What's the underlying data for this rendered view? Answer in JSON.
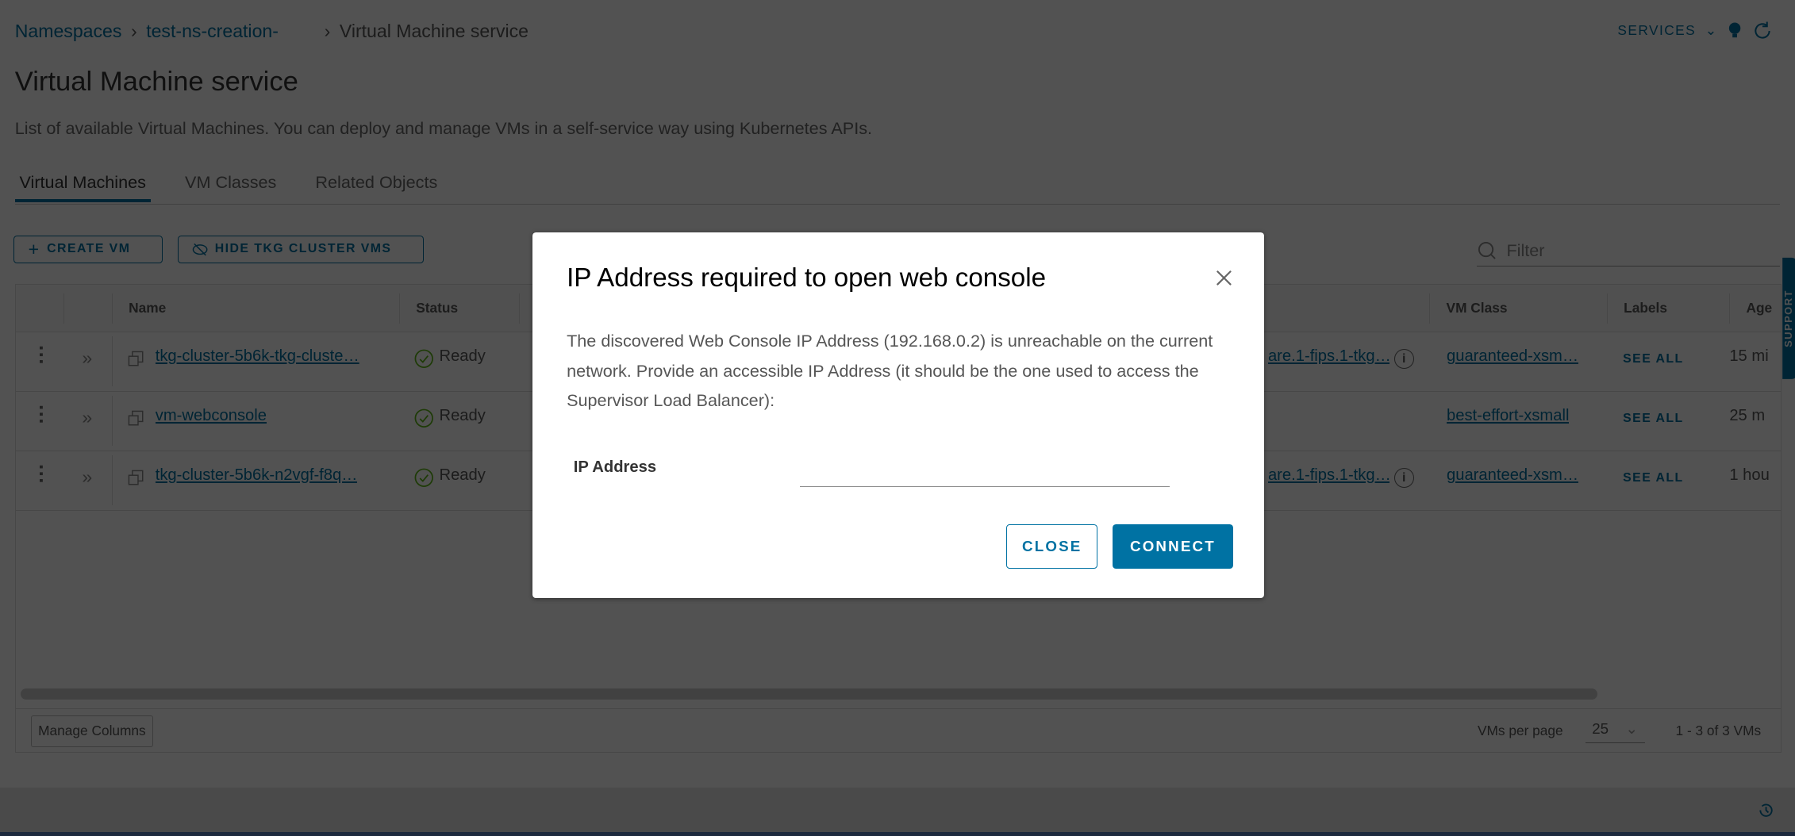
{
  "breadcrumb": [
    "Namespaces",
    "test-ns-creation-",
    "Virtual Machine service"
  ],
  "header": {
    "services_label": "SERVICES",
    "title": "Virtual Machine service",
    "description": "List of available Virtual Machines. You can deploy and manage VMs in a self-service way using Kubernetes APIs."
  },
  "tabs": [
    {
      "label": "Virtual Machines",
      "active": true
    },
    {
      "label": "VM Classes"
    },
    {
      "label": "Related Objects"
    }
  ],
  "toolbar": {
    "create_vm": "CREATE VM",
    "hide_tkg": "HIDE TKG CLUSTER VMS",
    "filter_placeholder": "Filter"
  },
  "table": {
    "columns": [
      "Name",
      "Status",
      "VM Class",
      "Labels",
      "Age"
    ],
    "rows": [
      {
        "name": "tkg-cluster-5b6k-tkg-cluste…",
        "status": "Ready",
        "image": "are.1-fips.1-tkg…",
        "vm_class": "guaranteed-xsm…",
        "labels": "SEE ALL",
        "age": "15 mi"
      },
      {
        "name": "vm-webconsole",
        "status": "Ready",
        "image": "",
        "vm_class": "best-effort-xsmall",
        "labels": "SEE ALL",
        "age": "25 m"
      },
      {
        "name": "tkg-cluster-5b6k-n2vgf-f8q…",
        "status": "Ready",
        "image": "are.1-fips.1-tkg…",
        "vm_class": "guaranteed-xsm…",
        "labels": "SEE ALL",
        "age": "1 hou"
      }
    ],
    "manage_columns": "Manage Columns",
    "per_page_label": "VMs per page",
    "per_page": "25",
    "range": "1 - 3 of 3 VMs"
  },
  "support_tab": "SUPPORT",
  "modal": {
    "title": "IP Address required to open web console",
    "body": "The discovered Web Console IP Address (192.168.0.2) is unreachable on the current network. Provide an accessible IP Address (it should be the one used to access the Supervisor Load Balancer):",
    "field_label": "IP Address",
    "field_value": "",
    "close": "CLOSE",
    "connect": "CONNECT"
  },
  "colors": {
    "accent": "#0072a3",
    "ready": "#5eb715"
  }
}
